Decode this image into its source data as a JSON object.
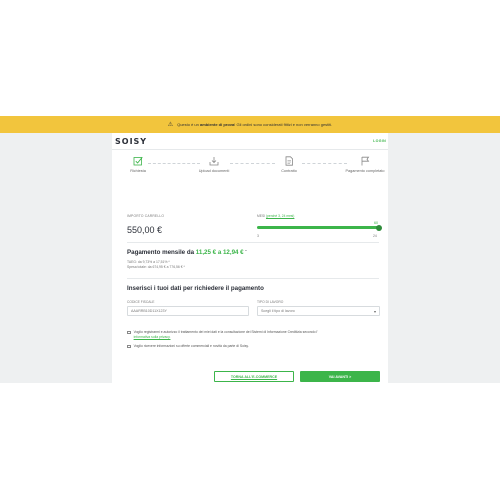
{
  "banner": {
    "icon": "warning-icon",
    "text_before": "Questo è un",
    "text_bold": "ambiente di prova",
    "text_after": "! Gli ordini sono considerati fittizi e non verranno gestiti."
  },
  "header": {
    "logo": "SOISY",
    "login_label": "LOGIN"
  },
  "steps": [
    {
      "icon": "check-square-icon",
      "label": "Richiesta"
    },
    {
      "icon": "upload-icon",
      "label": "Upload documenti"
    },
    {
      "icon": "document-icon",
      "label": "Contratto"
    },
    {
      "icon": "flag-icon",
      "label": "Pagamento completato"
    }
  ],
  "amount": {
    "label": "IMPORTO CARRELLO",
    "value": "550,00 €"
  },
  "months": {
    "label_prefix": "MESI",
    "label_link": "(perché 3, 24 mesi)",
    "selected": "60",
    "selected_fraction": 1.0,
    "min": "3",
    "max": "24"
  },
  "payment": {
    "title_prefix": "Pagamento mensile da",
    "range": "11,25 € a 12,94 €",
    "range_mark": "*",
    "taeg": "TAEG: da 9,73% a 17,51% *",
    "total": "Spesa totale: da 674,95 € a 776,56 € *"
  },
  "form": {
    "title": "Inserisci i tuoi dati per richiedere il pagamento",
    "fiscal_code_label": "CODICE FISCALE",
    "fiscal_code_value": "AAARRB10D11X123Y",
    "job_type_label": "TIPO DI LAVORO",
    "job_type_value": "Scegli il tipo di lavoro"
  },
  "consents": [
    {
      "text": "Voglio registrarmi e autorizzo il trattamento dei miei dati e la consultazione dei Sistemi di Informazione Creditizia secondo l'",
      "link": "informativa sulla privacy."
    },
    {
      "text": "Voglio ricevere informazioni su offerte commerciali e novità da parte di Soisy.",
      "link": ""
    }
  ],
  "buttons": {
    "back": "TORNA ALL'E-COMMERCE",
    "continue": "VAI AVANTI >"
  },
  "colors": {
    "accent": "#3cb54a",
    "banner": "#f2c53d"
  }
}
